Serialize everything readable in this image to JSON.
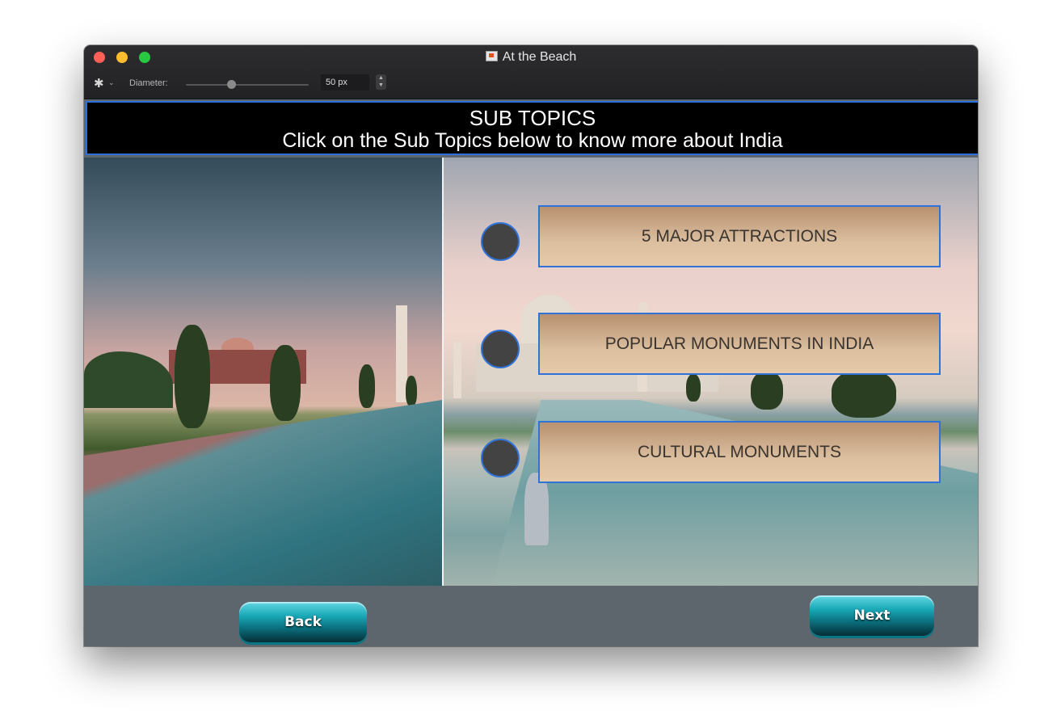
{
  "window": {
    "title": "At the Beach"
  },
  "toolbar": {
    "diameter_label": "Diameter:",
    "diameter_value": "50 px",
    "slider_fraction": 0.37
  },
  "banner": {
    "title": "SUB TOPICS",
    "subtitle": "Click on the Sub Topics below to know more about India"
  },
  "topics": [
    {
      "label": "5 MAJOR ATTRACTIONS"
    },
    {
      "label": "POPULAR MONUMENTS IN INDIA"
    },
    {
      "label": "CULTURAL MONUMENTS"
    }
  ],
  "nav": {
    "back_label": "Back",
    "next_label": "Next"
  },
  "colors": {
    "accent_border": "#2f73d9",
    "button_fill": "#d8b999",
    "nav_teal": "#19a7b6"
  }
}
